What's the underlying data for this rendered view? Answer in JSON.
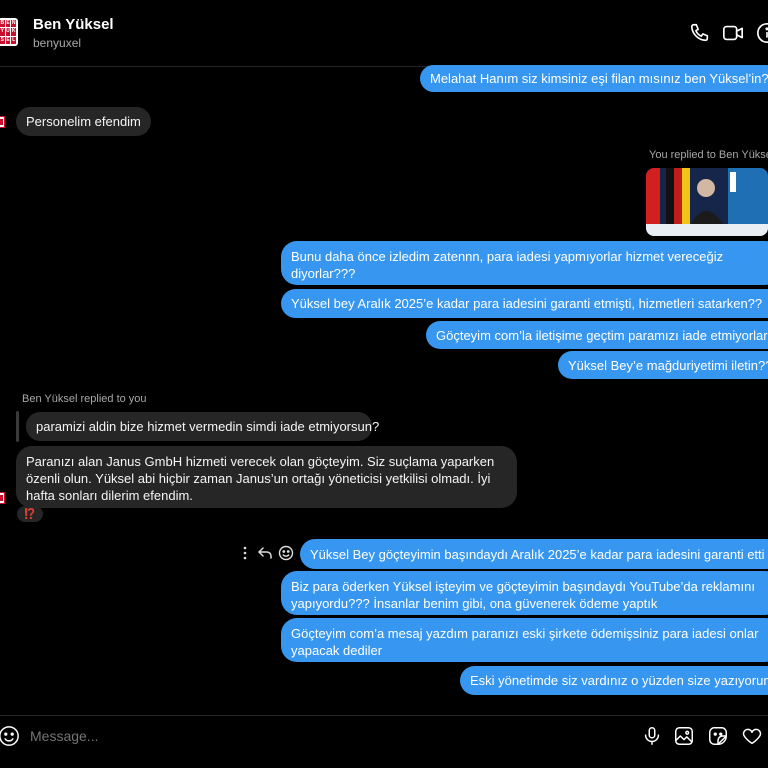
{
  "header": {
    "logo_letters": [
      "B",
      "E",
      "N",
      "Y",
      "Ü",
      "K",
      "S",
      "E",
      "L"
    ],
    "name": "Ben Yüksel",
    "username": "benyuxel",
    "icons": [
      "phone-icon",
      "video-icon",
      "info-icon"
    ]
  },
  "messages": {
    "m1": "Melahat Hanım siz kimsiniz eşi filan mısınız ben Yüksel’in??",
    "m2": "Personelim efendim",
    "reply_meta_1": "You replied to Ben Yüksel",
    "m3": "Bunu daha önce izledim zatennn, para iadesi yapmıyorlar hizmet vereceğiz diyorlar???",
    "m4": "Yüksel bey Aralık 2025’e kadar para iadesini garanti etmişti, hizmetleri satarken??",
    "m5": "Göçteyim com’la iletişime geçtim paramızı iade etmiyorlar",
    "m6": "Yüksel Bey’e mağduriyetimi iletin??",
    "reply_meta_2": "Ben Yüksel replied to you",
    "quote": "paramizi aldin bize hizmet vermedin simdi iade etmiyorsun?",
    "m7": "Paranızı alan Janus GmbH hizmeti verecek olan göçteyim.  Siz suçlama yaparken özenli olun.  Yüksel abi hiçbir zaman Janus’un ortağı yöneticisi yetkilisi olmadı. İyi hafta sonları dilerim efendim.",
    "reaction": "⁉️",
    "m8": "Yüksel Bey göçteyimin başındaydı Aralık 2025’e kadar para iadesini garanti etti",
    "m9": "Biz para öderken Yüksel işteyim ve göçteyimin başındaydı YouTube’da reklamını yapıyordu??? İnsanlar benim gibi, ona güvenerek ödeme yaptık",
    "m10": "Göçteyim com’a mesaj yazdım paranızı eski şirkete ödemişsiniz para iadesi onlar yapacak dediler",
    "m11": "Eski yönetimde siz vardınız o yüzden size yazıyorum"
  },
  "composer": {
    "placeholder": "Message...",
    "icons": [
      "emoji-icon",
      "microphone-icon",
      "image-icon",
      "sticker-icon",
      "heart-icon"
    ]
  },
  "colors": {
    "outgoing": "#3797f0",
    "incoming": "#262626",
    "background": "#000000"
  }
}
